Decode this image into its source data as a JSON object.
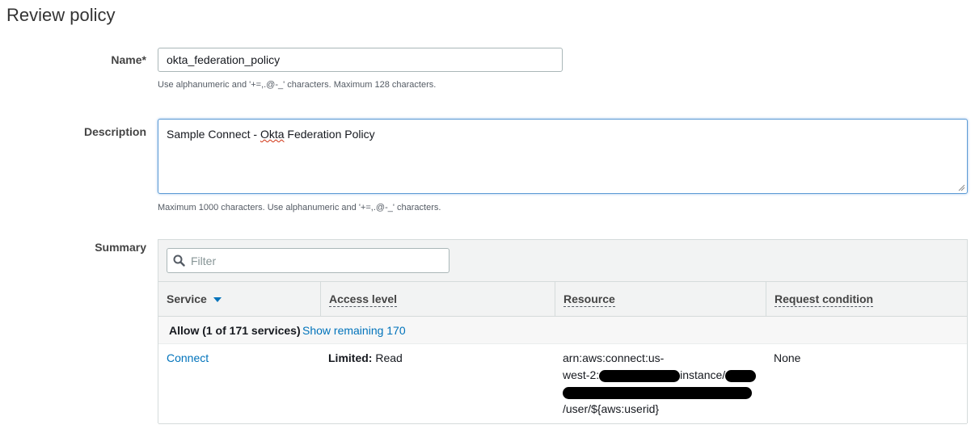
{
  "page": {
    "title": "Review policy"
  },
  "name_field": {
    "label": "Name*",
    "value": "okta_federation_policy",
    "hint": "Use alphanumeric and '+=,.@-_' characters. Maximum 128 characters."
  },
  "description_field": {
    "label": "Description",
    "value_before": "Sample Connect - ",
    "value_misspelled": "Okta",
    "value_after": " Federation Policy",
    "hint": "Maximum 1000 characters. Use alphanumeric and '+=,.@-_' characters."
  },
  "summary": {
    "label": "Summary",
    "filter_placeholder": "Filter",
    "columns": {
      "service": "Service",
      "access_level": "Access level",
      "resource": "Resource",
      "request_condition": "Request condition"
    },
    "group": {
      "title": "Allow (1 of 171 services)",
      "link": "Show remaining 170"
    },
    "row": {
      "service": "Connect",
      "access_label": "Limited:",
      "access_value": "Read",
      "resource_line1": "arn:aws:connect:us-",
      "resource_line2_start": "west-2:",
      "resource_line2_mid": "instance/",
      "resource_line4": "/user/${aws:userid}",
      "condition": "None"
    }
  },
  "colors": {
    "link": "#0073bb",
    "focus_border": "#5d9bd5"
  }
}
